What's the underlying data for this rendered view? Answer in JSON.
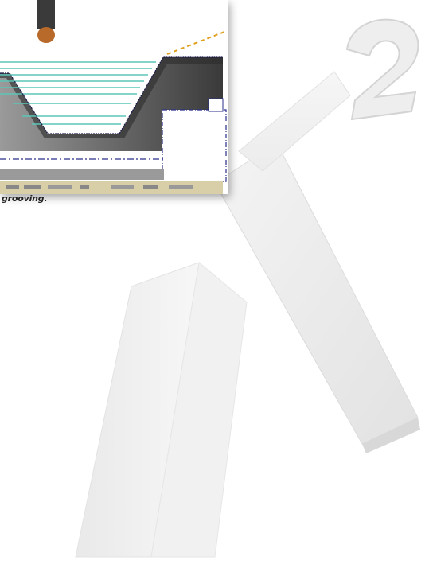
{
  "caption": "grooving.",
  "logo": {
    "letter": "X",
    "superscript": "2"
  },
  "colors": {
    "toolpath": "#5cc6b8",
    "boundary": "#2a2f8a",
    "tool_tip": "#b86a2a",
    "rapid_move": "#e0a020",
    "stock": "#5a5a5a"
  },
  "icons": {
    "screenshot_frame": "cad-viewport",
    "statusbar": "statusbar-strip"
  }
}
